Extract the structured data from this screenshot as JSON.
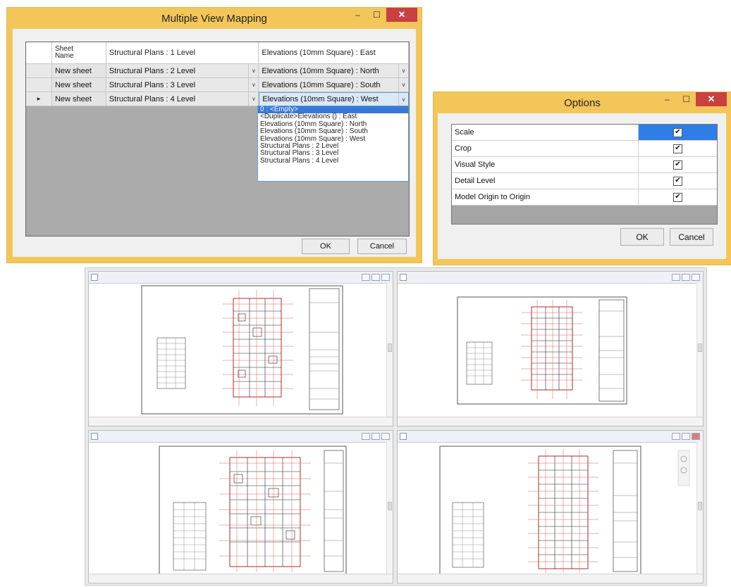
{
  "mapping_window": {
    "title": "Multiple View Mapping",
    "controls": {
      "minimize": "–",
      "maximize": "☐",
      "close": "✕"
    },
    "columns": {
      "sheet_name": "Sheet\nName",
      "plan": "Structural Plans : 1 Level",
      "elevation": "Elevations (10mm Square) : East"
    },
    "rows": [
      {
        "sheet": "New sheet",
        "plan": "Structural Plans : 2 Level",
        "elevation": "Elevations (10mm Square) : North"
      },
      {
        "sheet": "New sheet",
        "plan": "Structural Plans : 3 Level",
        "elevation": "Elevations (10mm Square) : South"
      },
      {
        "sheet": "New sheet",
        "plan": "Structural Plans : 4 Level",
        "elevation": "Elevations (10mm Square) : West"
      }
    ],
    "row_indicator": "▸",
    "dropdown_arrow": "∨",
    "dropdown_options": [
      "0 : <Empty>",
      "<Duplicate>Elevations () : East",
      "Elevations (10mm Square) : North",
      "Elevations (10mm Square) : South",
      "Elevations (10mm Square) : West",
      "Structural Plans : 2 Level",
      "Structural Plans : 3 Level",
      "Structural Plans : 4 Level"
    ],
    "ok_label": "OK",
    "cancel_label": "Cancel"
  },
  "options_window": {
    "title": "Options",
    "controls": {
      "minimize": "–",
      "maximize": "☐",
      "close": "✕"
    },
    "items": [
      {
        "label": "Scale",
        "checked": true
      },
      {
        "label": "Crop",
        "checked": true
      },
      {
        "label": "Visual Style",
        "checked": true
      },
      {
        "label": "Detail Level",
        "checked": true
      },
      {
        "label": "Model Origin to Origin",
        "checked": true
      }
    ],
    "check_mark": "✔",
    "ok_label": "OK",
    "cancel_label": "Cancel"
  },
  "colors": {
    "title_bar": "#f3c65a",
    "close_button": "#c84040",
    "selection_blue": "#2f7ee8",
    "grid_line_red": "#d46060"
  }
}
